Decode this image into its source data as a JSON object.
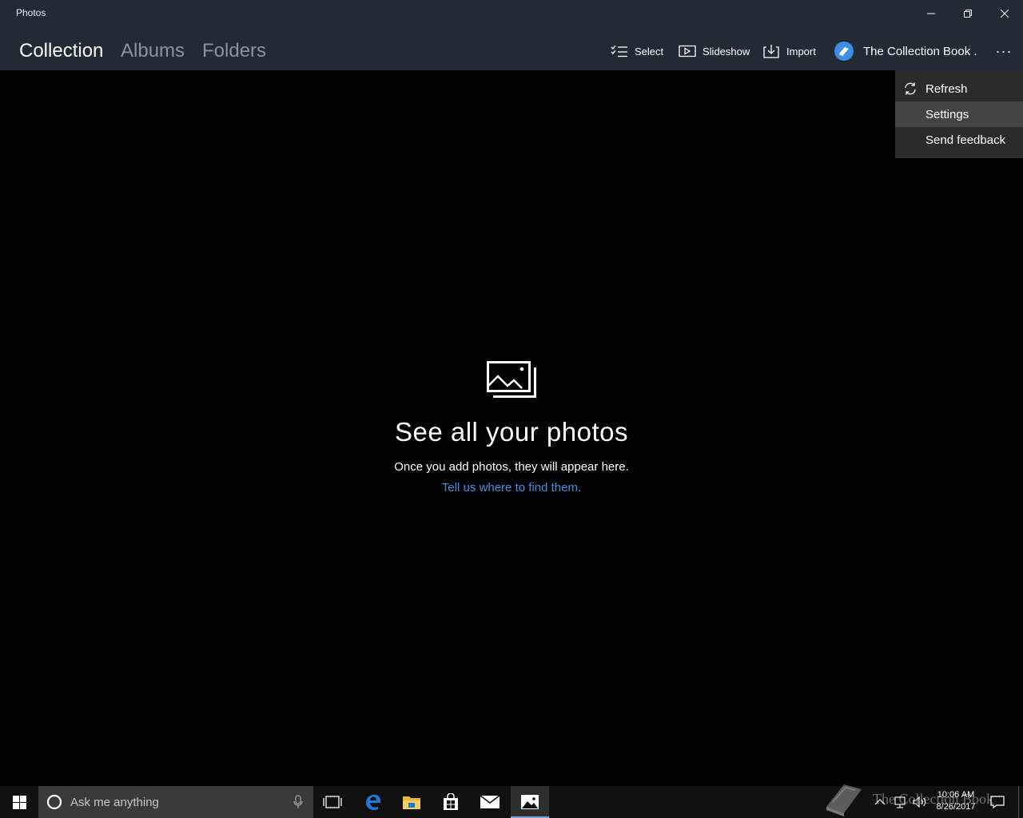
{
  "window": {
    "title": "Photos"
  },
  "nav": {
    "tabs": [
      {
        "label": "Collection",
        "active": true
      },
      {
        "label": "Albums",
        "active": false
      },
      {
        "label": "Folders",
        "active": false
      }
    ]
  },
  "commands": {
    "select": "Select",
    "slideshow": "Slideshow",
    "import": "Import",
    "account": "The Collection Book .",
    "more": "···"
  },
  "menu": {
    "items": [
      {
        "label": "Refresh",
        "icon": "refresh-icon"
      },
      {
        "label": "Settings",
        "hover": true
      },
      {
        "label": "Send feedback"
      }
    ]
  },
  "empty_state": {
    "icon": "photos-icon",
    "title": "See all your photos",
    "subtitle": "Once you add photos, they will appear here.",
    "link": "Tell us where to find them."
  },
  "taskbar": {
    "search_placeholder": "Ask me anything",
    "clock_time": "10:06 AM",
    "clock_date": "8/26/2017",
    "pinned": [
      "task-view-icon",
      "edge-icon",
      "file-explorer-icon",
      "store-icon",
      "mail-icon",
      "photos-icon"
    ],
    "watermark_text": "The Collection Book"
  },
  "colors": {
    "header_bg": "#222a36",
    "link": "#3a93e8",
    "menu_bg": "#2b2b2b",
    "taskbar_bg": "#101010"
  }
}
